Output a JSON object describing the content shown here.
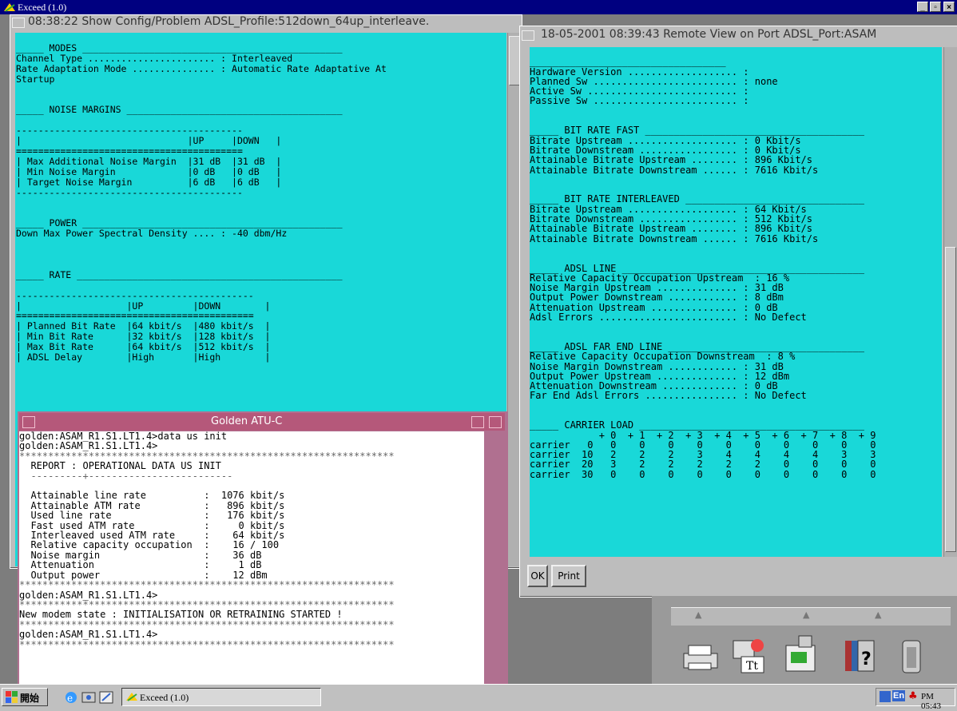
{
  "app": {
    "title": "Exceed (1.0)"
  },
  "left_window": {
    "title": "08:38:22  Show Config/Problem  ADSL_Profile:512down_64up_interleave.",
    "lines": [
      "",
      "_____ MODES _______________________________________________",
      "Channel Type ....................... : Interleaved",
      "Rate Adaptation Mode ............... : Automatic Rate Adaptative At",
      "Startup",
      "",
      "",
      "_____ NOISE MARGINS _______________________________________",
      "",
      "-----------------------------------------",
      "|                              |UP     |DOWN   |",
      "=========================================",
      "| Max Additional Noise Margin  |31 dB  |31 dB  |",
      "| Min Noise Margin             |0 dB   |0 dB   |",
      "| Target Noise Margin          |6 dB   |6 dB   |",
      "-----------------------------------------",
      "",
      "",
      "_____ POWER _______________________________________________",
      "Down Max Power Spectral Density .... : -40 dbm/Hz",
      "",
      "",
      "",
      "_____ RATE ________________________________________________",
      "",
      "-------------------------------------------",
      "|                   |UP         |DOWN        |",
      "===========================================",
      "| Planned Bit Rate  |64 kbit/s  |480 kbit/s  |",
      "| Min Bit Rate      |32 kbit/s  |128 kbit/s  |",
      "| Max Bit Rate      |64 kbit/s  |512 kbit/s  |",
      "| ADSL Delay        |High       |High        |"
    ]
  },
  "right_window": {
    "title": "18-05-2001 08:39:43  Remote View on Port    ADSL_Port:ASAM",
    "lines": [
      "",
      "__________________________________",
      "Hardware Version ................... :",
      "Planned Sw ......................... : none",
      "Active Sw .......................... :",
      "Passive Sw ......................... :",
      "",
      "",
      "_____ BIT RATE FAST ______________________________________",
      "Bitrate Upstream ................... : 0 Kbit/s",
      "Bitrate Downstream ................. : 0 Kbit/s",
      "Attainable Bitrate Upstream ........ : 896 Kbit/s",
      "Attainable Bitrate Downstream ...... : 7616 Kbit/s",
      "",
      "",
      "_____ BIT RATE INTERLEAVED _______________________________",
      "Bitrate Upstream ................... : 64 Kbit/s",
      "Bitrate Downstream ................. : 512 Kbit/s",
      "Attainable Bitrate Upstream ........ : 896 Kbit/s",
      "Attainable Bitrate Downstream ...... : 7616 Kbit/s",
      "",
      "",
      "_____ ADSL LINE __________________________________________",
      "Relative Capacity Occupation Upstream  : 16 %",
      "Noise Margin Upstream .............. : 31 dB",
      "Output Power Downstream ............ : 8 dBm",
      "Attenuation Upstream ............... : 0 dB",
      "Adsl Errors ........................ : No Defect",
      "",
      "",
      "_____ ADSL FAR END LINE __________________________________",
      "Relative Capacity Occupation Downstream  : 8 %",
      "Noise Margin Downstream ............ : 31 dB",
      "Output Power Upstream .............. : 12 dBm",
      "Attenuation Downstream ............. : 0 dB",
      "Far End Adsl Errors ................ : No Defect",
      "",
      "",
      "_____ CARRIER LOAD _______________________________________",
      "            + 0  + 1  + 2  + 3  + 4  + 5  + 6  + 7  + 8  + 9",
      "carrier   0   0    0    0    0    0    0    0    0    0    0",
      "carrier  10   2    2    2    3    4    4    4    4    3    3",
      "carrier  20   3    2    2    2    2    2    0    0    0    0",
      "carrier  30   0    0    0    0    0    0    0    0    0    0"
    ],
    "ok_label": "OK",
    "print_label": "Print"
  },
  "golden": {
    "title": "Golden ATU-C",
    "lines": [
      "golden:ASAM_R1.S1.LT1.4>data us init",
      "golden:ASAM_R1.S1.LT1.4>",
      "*****************************************************************",
      "  REPORT : OPERATIONAL DATA US INIT",
      "  ---------+-------------------------",
      "",
      "  Attainable line rate          :  1076 kbit/s",
      "  Attainable ATM rate           :   896 kbit/s",
      "  Used line rate                :   176 kbit/s",
      "  Fast used ATM rate            :     0 kbit/s",
      "  Interleaved used ATM rate     :    64 kbit/s",
      "  Relative capacity occupation  :    16 / 100",
      "  Noise margin                  :    36 dB",
      "  Attenuation                   :     1 dB",
      "  Output power                  :    12 dBm",
      "*****************************************************************",
      "golden:ASAM_R1.S1.LT1.4>",
      "*****************************************************************",
      "New modem state : INITIALISATION OR RETRAINING STARTED !",
      "*****************************************************************",
      "golden:ASAM_R1.S1.LT1.4>",
      "*****************************************************************"
    ]
  },
  "taskbar": {
    "start_label": "開始",
    "task_label": "Exceed (1.0)",
    "ime_label": "En",
    "clock": "PM 05:43"
  },
  "icons": [
    "printer-icon",
    "fonts-icon",
    "fax-icon",
    "books-help-icon",
    "trash-icon"
  ],
  "colors": {
    "terminal_bg": "#19d8d8",
    "title_bar": "#000080",
    "golden_title": "#b5587a"
  }
}
